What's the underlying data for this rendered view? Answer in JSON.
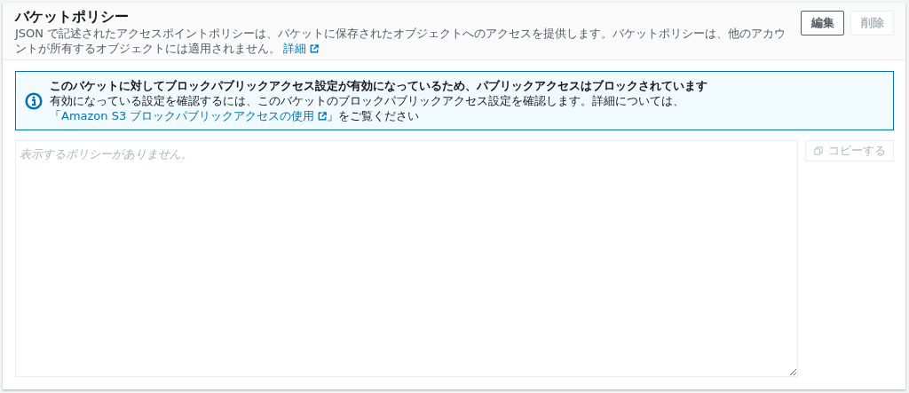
{
  "header": {
    "title": "バケットポリシー",
    "description": "JSON で記述されたアクセスポイントポリシーは、バケットに保存されたオブジェクトへのアクセスを提供します。バケットポリシーは、他のアカウントが所有するオブジェクトには適用されません。",
    "link": "詳細"
  },
  "buttons": [
    {
      "label": "編集",
      "disabled": false
    },
    {
      "label": "削除",
      "disabled": true
    }
  ],
  "alert": {
    "title": "このバケットに対してブロックパブリックアクセス設定が有効になっているため、パブリックアクセスはブロックされています",
    "body_before": "有効になっている設定を確認するには、このバケットのブロックパブリックアクセス設定を確認します。詳細については、「",
    "link": "Amazon S3 ブロックパブリックアクセスの使用",
    "body_after": "」をご覧ください"
  },
  "policy": {
    "placeholder": "表示するポリシーがありません。"
  },
  "copy_button": {
    "label": "コピーする",
    "disabled": true
  }
}
